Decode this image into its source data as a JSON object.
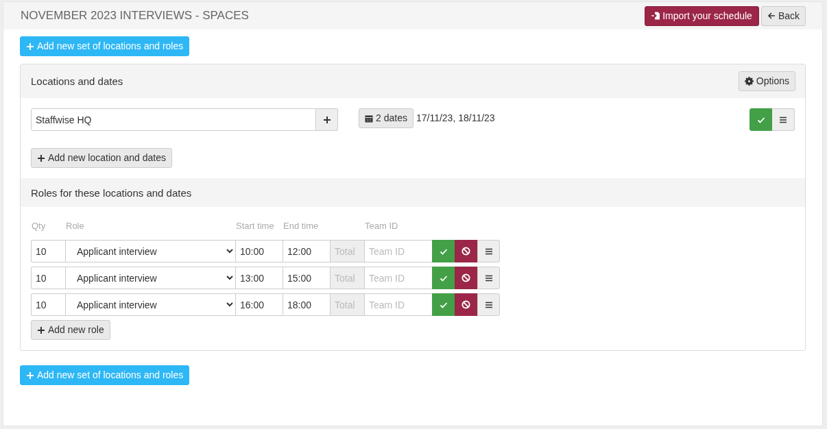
{
  "header": {
    "title": "NOVEMBER 2023 INTERVIEWS - SPACES",
    "import_button": "Import your schedule",
    "back_button": "Back"
  },
  "add_set_top": "Add new set of locations and roles",
  "panel": {
    "title": "Locations and dates",
    "options_button": "Options",
    "locations": [
      {
        "name": "Staffwise HQ",
        "dates_button": "2 dates",
        "dates": "17/11/23, 18/11/23"
      }
    ],
    "add_location_button": "Add new location and dates",
    "roles_title": "Roles for these locations and dates",
    "columns": [
      "Qty",
      "Role",
      "Start time",
      "End time",
      "Team ID"
    ],
    "roles": [
      {
        "qty": "10",
        "role": "Applicant interview",
        "start": "10:00",
        "end": "12:00",
        "total_placeholder": "Total",
        "team_placeholder": "Team ID"
      },
      {
        "qty": "10",
        "role": "Applicant interview",
        "start": "13:00",
        "end": "15:00",
        "total_placeholder": "Total",
        "team_placeholder": "Team ID"
      },
      {
        "qty": "10",
        "role": "Applicant interview",
        "start": "16:00",
        "end": "18:00",
        "total_placeholder": "Total",
        "team_placeholder": "Team ID"
      }
    ],
    "add_role_button": "Add new role"
  },
  "add_set_bottom": "Add new set of locations and roles"
}
